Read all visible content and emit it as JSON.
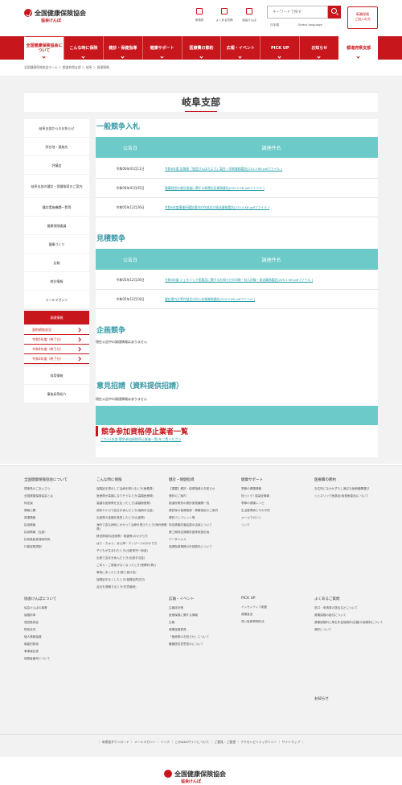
{
  "header": {
    "logo_name": "全国健康保険協会",
    "logo_sub": "協会けんぽ",
    "icons": [
      {
        "label": "申請書",
        "icon": "document-icon"
      },
      {
        "label": "よくある質問",
        "icon": "question-icon"
      },
      {
        "label": "協会けんぽ",
        "icon": "people-icon"
      }
    ],
    "search_placeholder": "キーワードで探す",
    "lang_jp": "日本語",
    "lang_select": "Select language",
    "join_line1": "転職保険",
    "join_line2": "ご加入の方"
  },
  "gnav": [
    {
      "label": "全国健康保険協会について"
    },
    {
      "label": "こんな時に保険"
    },
    {
      "label": "健診・保健指導"
    },
    {
      "label": "健康サポート"
    },
    {
      "label": "医療費の節約"
    },
    {
      "label": "広報・イベント"
    },
    {
      "label": "PICK UP"
    },
    {
      "label": "お知らせ"
    },
    {
      "label": "都道府県支部"
    }
  ],
  "breadcrumb": "全国健康保険協会ホーム ＞ 都道府県支部 ＞ 岐阜 ＞ 調達情報",
  "page_title": "岐阜支部",
  "sidebar": {
    "items": [
      "岐阜支部からのお知らせ",
      "所在地・連絡先",
      "評議会",
      "岐阜支部の健診・保健指導のご案内",
      "健診実施機関一覧等",
      "健康保険委員",
      "健康づくり",
      "広報",
      "統計情報",
      "メールマガジン"
    ],
    "active": "調達情報",
    "subitems": [
      "契約締結状況",
      "令和5年度（終了分）",
      "令和4年度（終了分）",
      "令和3年度（終了分）"
    ],
    "after": [
      "採用情報",
      "事務局等紹介"
    ]
  },
  "main": {
    "sec1": "一般競争入札",
    "col_date": "公告日",
    "col_name": "調達件名",
    "rows1": [
      {
        "date": "令和06年01月11日",
        "name": "令和6年度 広報紙「協会けんぽだより」製作・印刷業務委託[215.3 KB pdfファイル ]"
      },
      {
        "date": "令和06年01月05日",
        "name": "健康経営の普及推進に関する新聞広告業務委託[202.2 KB pdfファイル ]"
      },
      {
        "date": "令和05年12月26日",
        "name": "令和6年度事業所健診案内の作成及び発送業務委託[213.4 KB pdfファイル ]"
      }
    ],
    "sec2": "見積競争",
    "rows2": [
      {
        "date": "令和05年12月26日",
        "name": "令和6年度 ジェネリック医薬品に関するお知らせの印刷・封入封緘・発送業務委託[209.1 KB pdfファイル ]"
      },
      {
        "date": "令和05年12月18日",
        "name": "健診案内文等作製及び封入封緘業務委託[204.9 KB pdfファイル ]"
      }
    ],
    "sec3": "企画競争",
    "no_info": "現在公告中の調達情報はありません",
    "sec4": "意見招請（資料提供招請）",
    "sec5": "競争参加資格停止業者一覧",
    "link5": "こちら(本部:競争参加資格停止業者一覧)をご覧ください"
  },
  "footer": {
    "cols": [
      {
        "title": "全国健康保険協会について",
        "links": [
          "理事長のごあいさつ",
          "全国健康保険協会とは",
          "特定保",
          "情報公開",
          "調達情報",
          "採用情報",
          "採用情報（支部）",
          "採用高齢者運用特例",
          "行動保険規制"
        ]
      },
      {
        "title": "こんな時に保険",
        "links": [
          "保険証を提示して治療を受けるとき(療養費)",
          "医療費が高額になりそうなとき(高額医療費)",
          "高額な医療費を支払ったとき(高額療養費)",
          "病気やケガで会社を休んだとき(傷病手当金)",
          "出産費の金額を負担したとき(出産費)",
          "海外で急な病気にかかって治療を受けたとき(海外療養費)",
          "移送費用料(医療費・検査等)のかかり方",
          "はり・きゅう、あん摩・マッサージのかかり方",
          "子どもが生まれたとき(出産育児一時金)",
          "出産で会社を休んだとき(出産手当金)",
          "ご本人・ご家族がなくなったとき(埋葬料(費))",
          "事故にあったとき(第三者行為)",
          "保険証をなくしたとき(保険証再交付)",
          "会社を退職するとき(任意継続)"
        ]
      },
      {
        "title": "健診・保健指導",
        "links": [
          "【重要】健診・保健指導のお知らせ",
          "健診のご案内",
          "都道府県別の健診実施機関一覧",
          "健診後の保健指導・健康相談のご案内",
          "健診パンフレット等",
          "特定健康診査結果の活用について",
          "第三期特定健康診査等実施計画",
          "データヘルス",
          "保健指導業務の外部委託について"
        ]
      },
      {
        "title": "健康サポート",
        "links": [
          "季節の健康情報",
          "知っトク! 感染症情報",
          "季節の健康レシピ",
          "生活習慣病とその予防",
          "メールマガジン",
          "リンク"
        ]
      },
      {
        "title": "医療費の節約",
        "links": [
          "お住所になかかずらし適正な医療機関選び",
          "ジェネリック医薬品(後発医薬品)について"
        ]
      },
      {
        "title": "協会けんぽについて",
        "links": [
          "協会けんぽの事業",
          "保険料率",
          "運営委員会",
          "財政状況",
          "個人情報保護",
          "機能別検索",
          "事業報告書",
          "保険者番号について"
        ]
      },
      {
        "title": "",
        "links": []
      },
      {
        "title": "広報・イベント",
        "links": [
          "広報誌対策",
          "医療保険に関する情報",
          "広報",
          "健康保険委員",
          "「医療費のお知らせ」について",
          "臓器提供意思表示について"
        ]
      },
      {
        "title": "PICK UP",
        "links": [
          "インセンティブ制度",
          "健康宣言",
          "賢い医療費節約法"
        ]
      },
      {
        "title": "よくあるご質問",
        "links": [
          "窓口・申請書の提出などについて",
          "健康保険の給付について",
          "健康保険料と厚生年金保険料(定額)の保険料について",
          "健診について"
        ]
      }
    ],
    "extra_title": "お知らせ",
    "bar": "｜ 申請書ダウンロード ｜ メールマガジン ｜ リンク ｜ このWEBサイトについて ｜ ご意見・ご要望 ｜ アクセシビリティポリシー ｜ サイトマップ ｜"
  },
  "colors": {
    "brand": "#c8161d",
    "teal": "#6ccbc8",
    "link": "#1f9aa6"
  }
}
